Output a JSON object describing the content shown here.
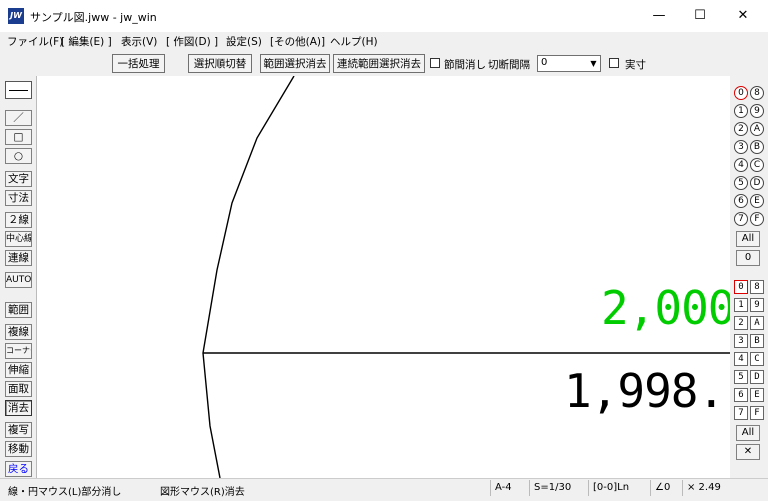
{
  "window": {
    "title": "サンプル図.jww - jw_win",
    "icon_text": "JW",
    "controls": {
      "minimize": "—",
      "maximize": "☐",
      "close": "✕"
    }
  },
  "menu": [
    "ファイル(F)",
    "[ 編集(E) ]",
    "表示(V)",
    "[ 作図(D) ]",
    "設定(S)",
    "[その他(A)]",
    "ヘルプ(H)"
  ],
  "toolbar": {
    "buttons": [
      "一括処理",
      "選択順切替",
      "範囲選択消去",
      "連続範囲選択消去"
    ],
    "checkbox_setsukan": "節間消し",
    "cut_interval_label": "切断間隔",
    "cut_interval_value": "0",
    "checkbox_jisun": "実寸"
  },
  "left_tools": [
    "／",
    "□",
    "○",
    "文字",
    "寸法",
    "２線",
    "中心線",
    "連線",
    "AUTO",
    "範囲",
    "複線",
    "コーナー",
    "伸縮",
    "面取",
    "消去",
    "複写",
    "移動",
    "戻る"
  ],
  "canvas": {
    "dim_text_green": "2,000",
    "dim_text_black": "1,998.",
    "accent_green": "#00cc00"
  },
  "right_panel": {
    "layers_top": [
      "0",
      "8",
      "1",
      "9",
      "2",
      "A",
      "3",
      "B",
      "4",
      "C",
      "5",
      "D",
      "6",
      "E",
      "7",
      "F"
    ],
    "all_label": "All",
    "zero_label": "0",
    "groups_bottom": [
      "0",
      "8",
      "1",
      "9",
      "2",
      "A",
      "3",
      "B",
      "4",
      "C",
      "5",
      "D",
      "6",
      "E",
      "7",
      "F"
    ],
    "all2_label": "All",
    "cross_label": "✕"
  },
  "status": {
    "left": "線・円マウス(L)部分消し",
    "mid": "図形マウス(R)消去",
    "paper": "A-4",
    "scale": "S=1/30",
    "layer": "[0-0]Ln",
    "angle": "∠0",
    "zoom": "× 2.49"
  }
}
